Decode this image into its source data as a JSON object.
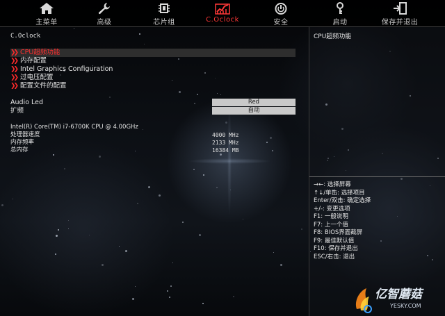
{
  "nav": {
    "tabs": [
      {
        "label": "主菜单",
        "icon": "home-icon",
        "active": false
      },
      {
        "label": "高级",
        "icon": "wrench-icon",
        "active": false
      },
      {
        "label": "芯片组",
        "icon": "chip-icon",
        "active": false
      },
      {
        "label": "C.Oclock",
        "icon": "oc-meter-icon",
        "active": true
      },
      {
        "label": "安全",
        "icon": "power-shield-icon",
        "active": false
      },
      {
        "label": "启动",
        "icon": "key-icon",
        "active": false
      },
      {
        "label": "保存并退出",
        "icon": "exit-icon",
        "active": false
      }
    ],
    "active_color": "#ff3838"
  },
  "main": {
    "title": "C.Oclock",
    "menu": [
      {
        "label": "CPU超频功能",
        "selected": true
      },
      {
        "label": "内存配置",
        "selected": false
      },
      {
        "label": "Intel Graphics Configuration",
        "selected": false
      },
      {
        "label": "过电压配置",
        "selected": false
      },
      {
        "label": "配置文件的配置",
        "selected": false
      }
    ],
    "settings": [
      {
        "label": "Audio Led",
        "value": "Red"
      },
      {
        "label": "扩频",
        "value": "自动"
      }
    ],
    "cpu_name": "Intel(R) Core(TM) i7-6700K CPU @ 4.00GHz",
    "info": [
      {
        "label": "处理器速度",
        "value": "4000 MHz"
      },
      {
        "label": "内存频率",
        "value": "2133 MHz"
      },
      {
        "label": "总内存",
        "value": "16384 MB"
      }
    ]
  },
  "help": {
    "title": "CPU超频功能",
    "keys": [
      "→←: 选择屏幕",
      "↑↓/单击: 选择项目",
      "Enter/双击: 确定选择",
      "+/-: 变更选项",
      "F1: 一般说明",
      "F7: 上一个值",
      "F8: BIOS界面截屏",
      "F9: 最佳默认值",
      "F10: 保存并退出",
      "ESC/右击: 退出"
    ]
  },
  "watermark": {
    "text": "亿智蘑菇",
    "sub": "YESKY.COM",
    "colors": {
      "accent": "#3aa0ff",
      "flame": "#ff8a1a"
    }
  }
}
